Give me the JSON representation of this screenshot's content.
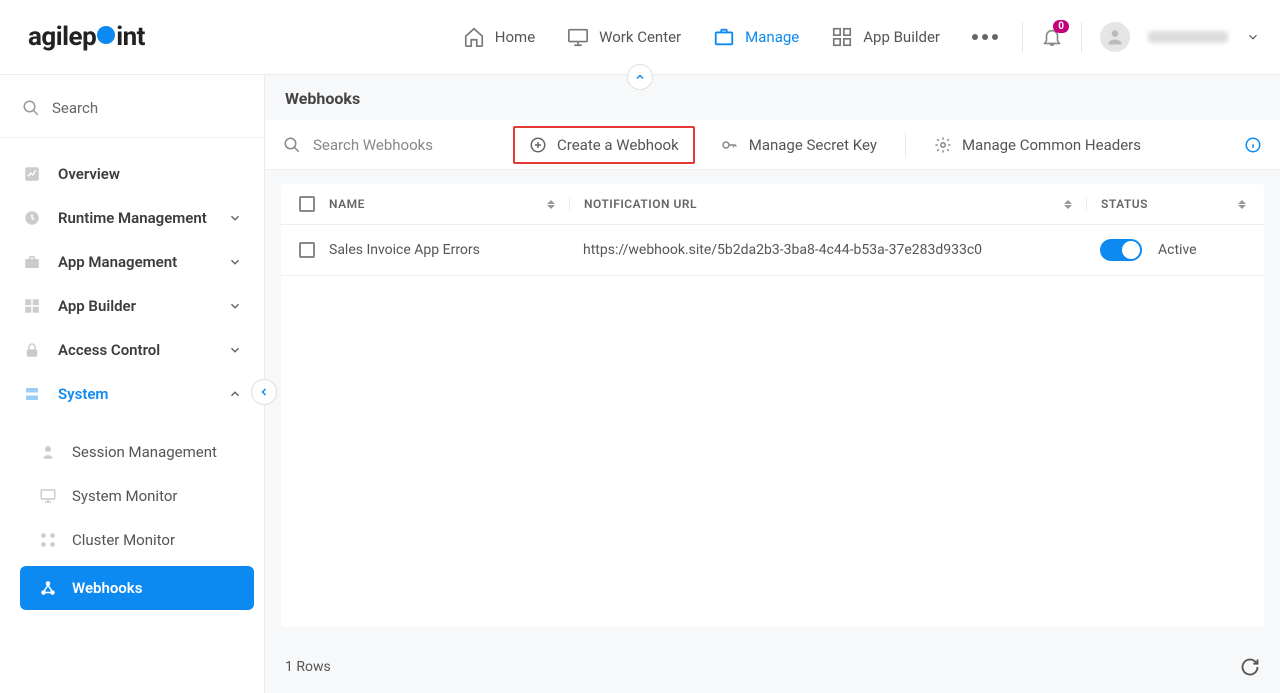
{
  "header": {
    "logo_text_pre": "agilep",
    "logo_text_post": "int",
    "nav": [
      {
        "label": "Home",
        "icon": "home",
        "active": false
      },
      {
        "label": "Work Center",
        "icon": "monitor",
        "active": false
      },
      {
        "label": "Manage",
        "icon": "briefcase",
        "active": true
      },
      {
        "label": "App Builder",
        "icon": "apps",
        "active": false
      }
    ],
    "notification_count": "0"
  },
  "sidebar": {
    "search_placeholder": "Search",
    "items": [
      {
        "label": "Overview",
        "icon": "chart"
      },
      {
        "label": "Runtime Management",
        "icon": "clock",
        "expandable": true
      },
      {
        "label": "App Management",
        "icon": "toolbox",
        "expandable": true
      },
      {
        "label": "App Builder",
        "icon": "grid",
        "expandable": true
      },
      {
        "label": "Access Control",
        "icon": "lock",
        "expandable": true
      },
      {
        "label": "System",
        "icon": "server",
        "expandable": true,
        "expanded": true,
        "active": true
      }
    ],
    "system_sub": [
      {
        "label": "Session Management",
        "icon": "user"
      },
      {
        "label": "System Monitor",
        "icon": "monitor"
      },
      {
        "label": "Cluster Monitor",
        "icon": "cluster"
      },
      {
        "label": "Webhooks",
        "icon": "webhook",
        "selected": true
      }
    ]
  },
  "page": {
    "title": "Webhooks",
    "toolbar": {
      "search_placeholder": "Search Webhooks",
      "create_label": "Create a Webhook",
      "manage_secret_label": "Manage Secret Key",
      "manage_headers_label": "Manage Common Headers"
    },
    "columns": {
      "name": "NAME",
      "url": "NOTIFICATION URL",
      "status": "STATUS"
    },
    "rows": [
      {
        "name": "Sales Invoice App Errors",
        "url": "https://webhook.site/5b2da2b3-3ba8-4c44-b53a-37e283d933c0",
        "status_label": "Active",
        "active": true
      }
    ],
    "row_count_label": "1 Rows"
  }
}
